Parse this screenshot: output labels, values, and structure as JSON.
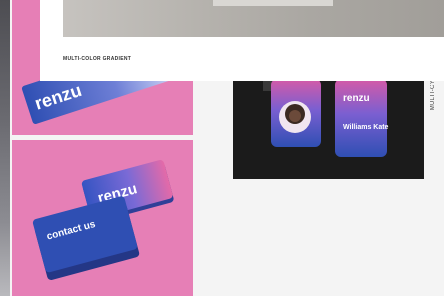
{
  "caption": "MULTI-COLOR GRADIENT",
  "side_label": "MULTI-CY",
  "brand": {
    "name": "renzu",
    "tagline": "contact us",
    "badge_person": "Williams Kate"
  },
  "colors": {
    "pink_bg": "#e67fb6",
    "card_blue": "#2f4fb3",
    "card_magenta": "#d85aa5",
    "dark_bg": "#1b1b1b"
  }
}
